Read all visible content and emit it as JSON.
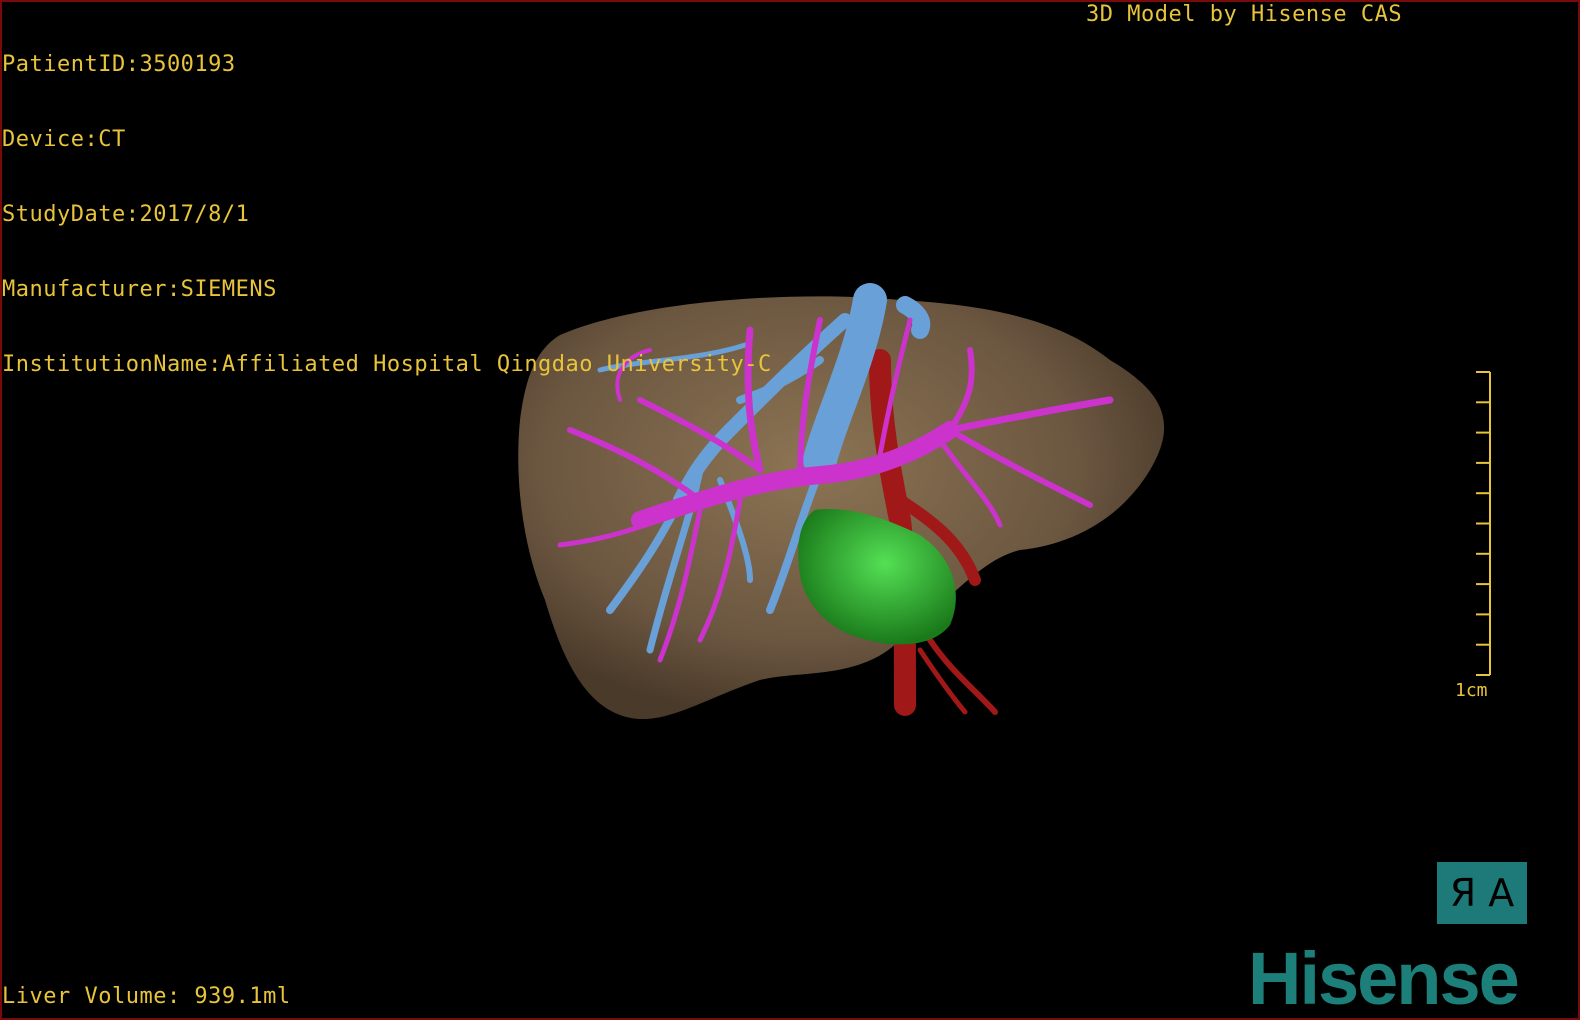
{
  "patient_info": {
    "patient_id": "PatientID:3500193",
    "device": "Device:CT",
    "study_date": "StudyDate:2017/8/1",
    "manufacturer": "Manufacturer:SIEMENS",
    "institution": "InstitutionName:Affiliated Hospital Qingdao University-C"
  },
  "credit": "3D Model by Hisense CAS",
  "liver_volume": "Liver Volume: 939.1ml",
  "scale": {
    "label": "1cm",
    "ticks": 10
  },
  "orientation": {
    "label": "Я А"
  },
  "logo": {
    "text": "Hisense"
  },
  "colors": {
    "overlay_text": "#e8c43a",
    "liver": "#7a6347",
    "portal_vein": "#cc33cc",
    "hepatic_vein": "#6aa0d8",
    "artery": "#a01818",
    "lesion": "#2fb02f",
    "brand": "#1d7f79"
  },
  "model": {
    "structures": [
      "liver",
      "hepatic-vein",
      "portal-vein",
      "hepatic-artery",
      "gallbladder"
    ]
  }
}
